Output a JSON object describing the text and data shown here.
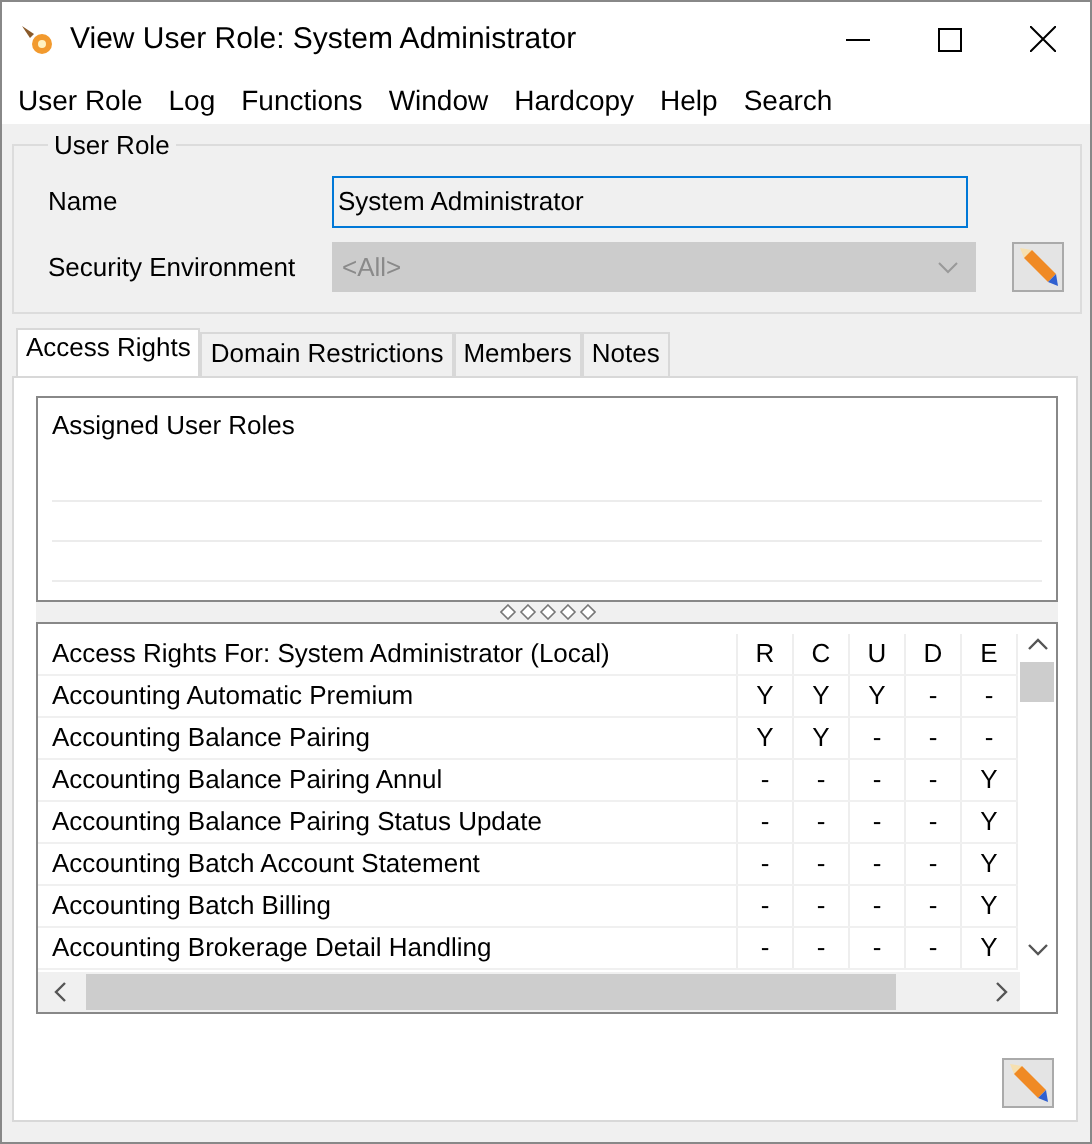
{
  "window": {
    "title": "View User Role: System Administrator"
  },
  "menu": [
    "User Role",
    "Log",
    "Functions",
    "Window",
    "Hardcopy",
    "Help",
    "Search"
  ],
  "user_role": {
    "legend": "User Role",
    "name_label": "Name",
    "name_value": "System Administrator",
    "env_label": "Security Environment",
    "env_value": "<All>",
    "env_disabled": true
  },
  "tabs": [
    {
      "label": "Access Rights",
      "selected": true
    },
    {
      "label": "Domain Restrictions",
      "selected": false
    },
    {
      "label": "Members",
      "selected": false
    },
    {
      "label": "Notes",
      "selected": false
    }
  ],
  "assigned": {
    "title": "Assigned User Roles"
  },
  "access_rights": {
    "columns": [
      "Access Rights For: System Administrator (Local)",
      "R",
      "C",
      "U",
      "D",
      "E"
    ],
    "rows": [
      {
        "cells": [
          "Accounting Automatic Premium",
          "Y",
          "Y",
          "Y",
          "-",
          "-"
        ]
      },
      {
        "cells": [
          "Accounting Balance Pairing",
          "Y",
          "Y",
          "-",
          "-",
          "-"
        ]
      },
      {
        "cells": [
          "Accounting Balance Pairing Annul",
          "-",
          "-",
          "-",
          "-",
          "Y"
        ]
      },
      {
        "cells": [
          "Accounting Balance Pairing Status Update",
          "-",
          "-",
          "-",
          "-",
          "Y"
        ]
      },
      {
        "cells": [
          "Accounting Batch Account Statement",
          "-",
          "-",
          "-",
          "-",
          "Y"
        ]
      },
      {
        "cells": [
          "Accounting Batch Billing",
          "-",
          "-",
          "-",
          "-",
          "Y"
        ]
      },
      {
        "cells": [
          "Accounting Brokerage Detail Handling",
          "-",
          "-",
          "-",
          "-",
          "Y"
        ]
      }
    ]
  }
}
